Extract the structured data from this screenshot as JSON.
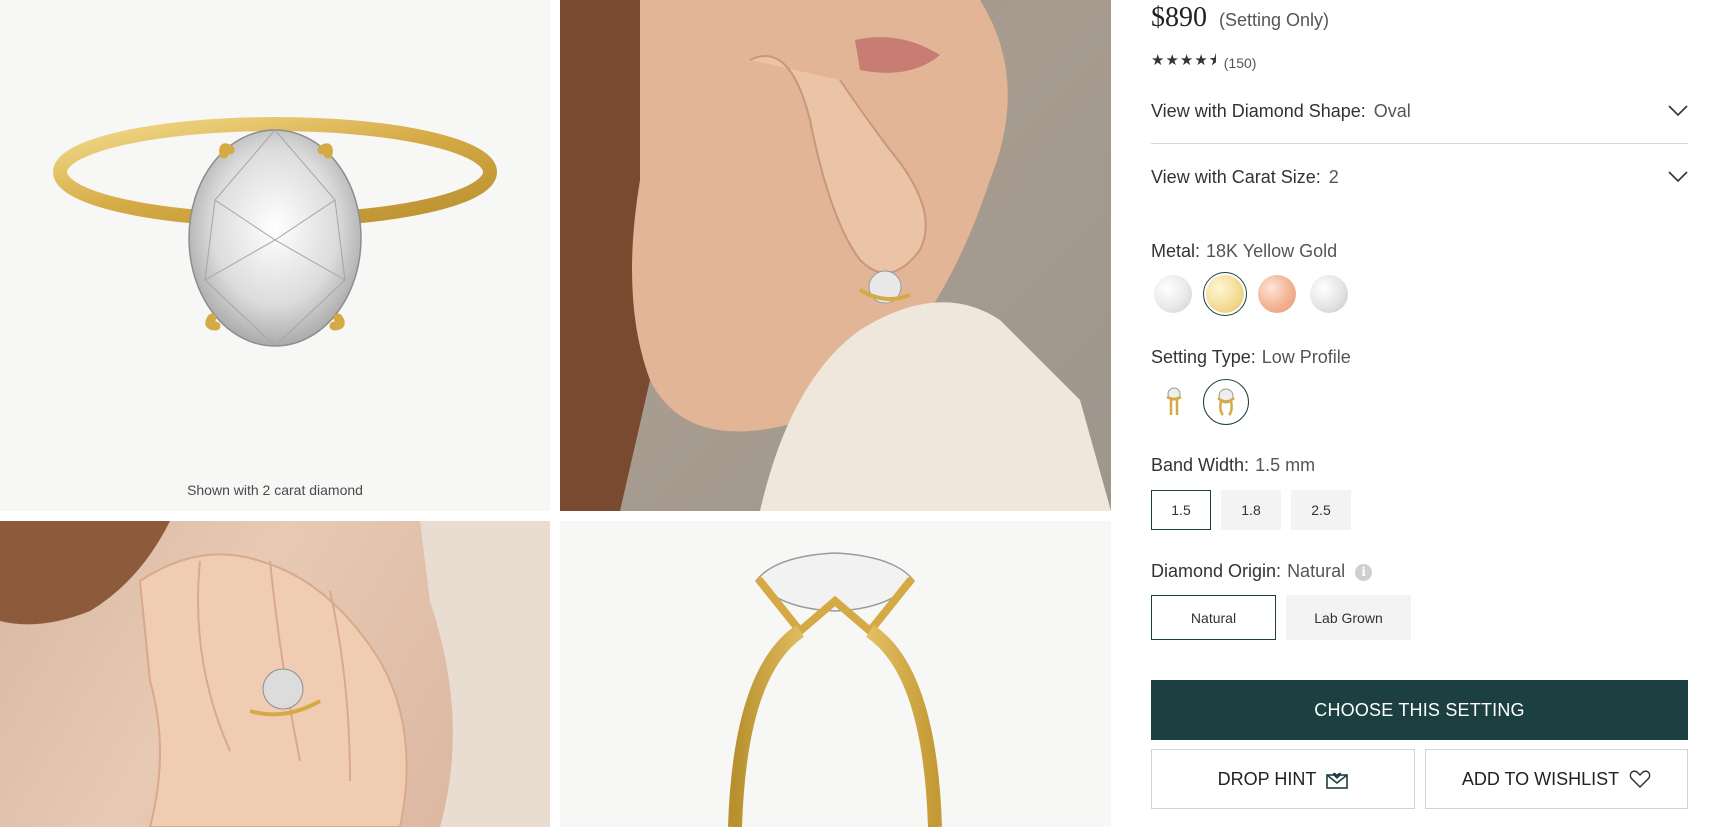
{
  "gallery": {
    "caption": "Shown with 2 carat diamond"
  },
  "product": {
    "price": "$890",
    "price_note": "(Setting Only)",
    "rating_stars": "★★★★⯨",
    "review_count": "(150)",
    "rating": 4.5
  },
  "options": {
    "diamond_shape": {
      "label": "View with Diamond Shape:",
      "value": "Oval"
    },
    "carat_size": {
      "label": "View with Carat Size:",
      "value": "2"
    },
    "metal": {
      "label": "Metal:",
      "value": "18K Yellow Gold",
      "swatch_colors": [
        "#e9e9e9",
        "#f3dc95",
        "#f2b293",
        "#e4e4e4"
      ],
      "selected_index": 1
    },
    "setting_type": {
      "label": "Setting Type:",
      "value": "Low Profile",
      "selected_index": 1
    },
    "band_width": {
      "label": "Band Width:",
      "value": "1.5 mm",
      "choices": [
        "1.5",
        "1.8",
        "2.5"
      ],
      "selected_index": 0
    },
    "diamond_origin": {
      "label": "Diamond Origin:",
      "value": "Natural",
      "choices": [
        "Natural",
        "Lab Grown"
      ],
      "selected_index": 0
    }
  },
  "actions": {
    "choose": "CHOOSE THIS SETTING",
    "hint": "DROP HINT",
    "wishlist": "ADD TO WISHLIST"
  },
  "colors": {
    "accent": "#1c3f41",
    "gold": "#d8b04a"
  }
}
